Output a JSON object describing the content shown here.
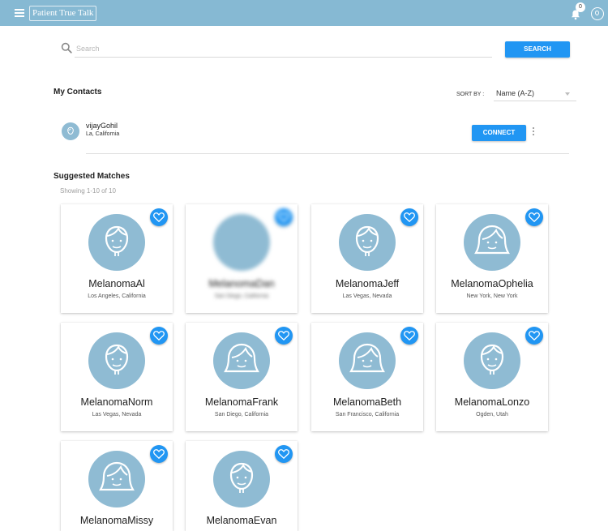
{
  "app": {
    "logo_text": "Patient True Talk",
    "notification_count": "0"
  },
  "search": {
    "placeholder": "Search",
    "value": "",
    "button_label": "SEARCH"
  },
  "contacts": {
    "title": "My Contacts",
    "sort_label": "SORT BY :",
    "sort_value": "Name (A-Z)",
    "items": [
      {
        "name": "vijayGohil",
        "location": "La, California",
        "action_label": "CONNECT"
      }
    ]
  },
  "matches": {
    "title": "Suggested Matches",
    "showing": "Showing 1-10 of 10",
    "cards": [
      {
        "name": "MelanomaAl",
        "location": "Los Angeles, California",
        "avatar": "male"
      },
      {
        "name": "MelanomaDan",
        "location": "San Diego, California",
        "avatar": "photo"
      },
      {
        "name": "MelanomaJeff",
        "location": "Las Vegas, Nevada",
        "avatar": "male"
      },
      {
        "name": "MelanomaOphelia",
        "location": "New York, New York",
        "avatar": "female"
      },
      {
        "name": "MelanomaNorm",
        "location": "Las Vegas, Nevada",
        "avatar": "male"
      },
      {
        "name": "MelanomaFrank",
        "location": "San Diego, California",
        "avatar": "female"
      },
      {
        "name": "MelanomaBeth",
        "location": "San Francisco, California",
        "avatar": "female"
      },
      {
        "name": "MelanomaLonzo",
        "location": "Ogden, Utah",
        "avatar": "male"
      },
      {
        "name": "MelanomaMissy",
        "location": "",
        "avatar": "female"
      },
      {
        "name": "MelanomaEvan",
        "location": "",
        "avatar": "male"
      }
    ]
  },
  "colors": {
    "topbar": "#86b9d3",
    "accent": "#2196f3",
    "avatar_bg": "#8fbbd3"
  },
  "icons": {
    "menu": "hamburger-icon",
    "bell": "bell-icon",
    "profile": "profile-icon",
    "search": "search-icon",
    "more": "more-vert-icon",
    "favorite": "heart-icon"
  }
}
